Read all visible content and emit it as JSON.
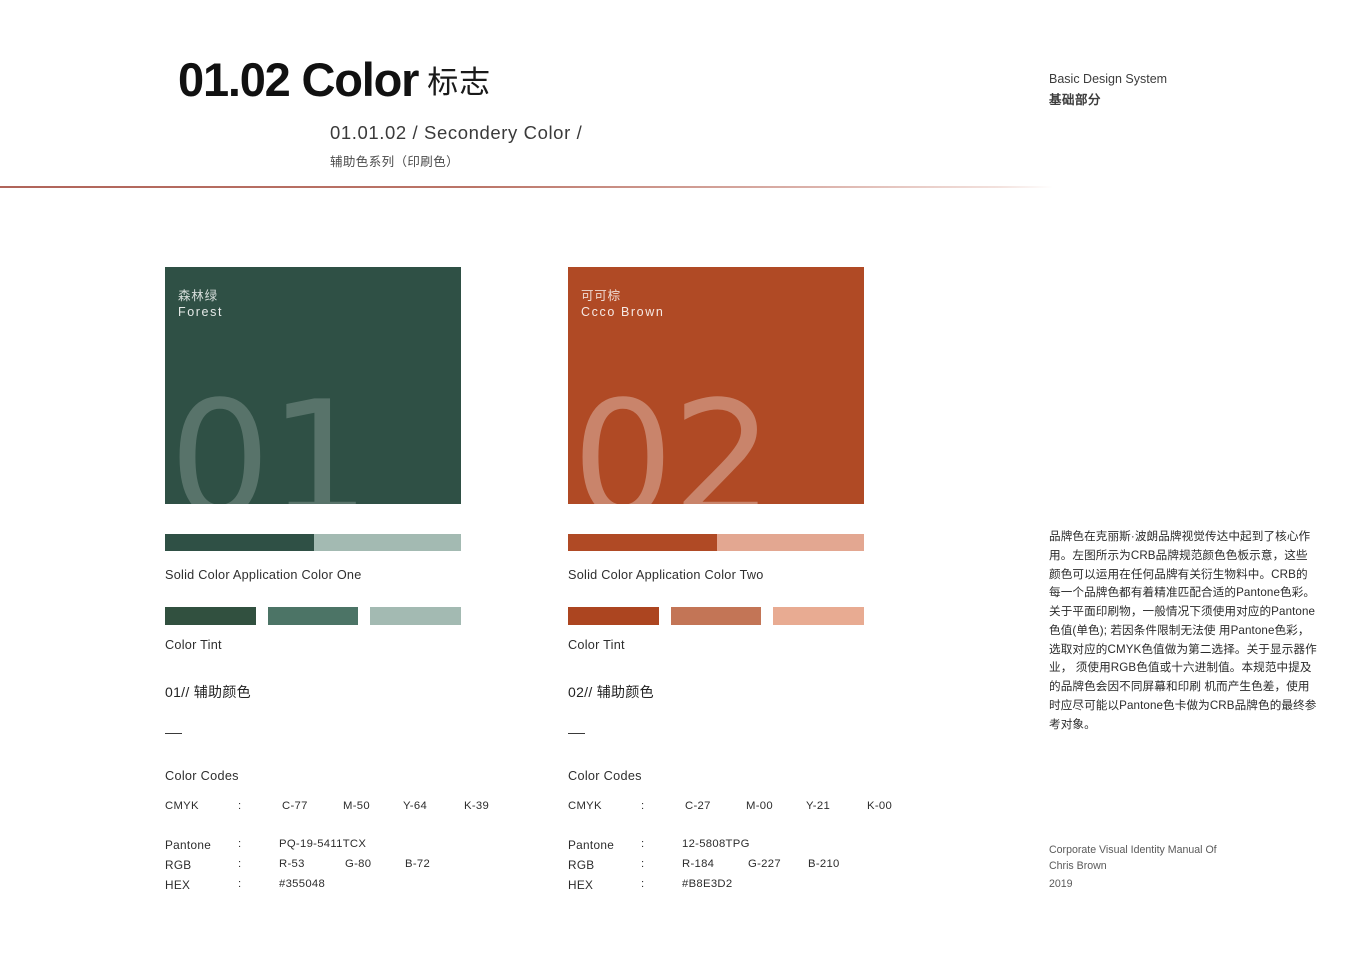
{
  "header": {
    "title_main": "01.02 Color",
    "title_cjk": "标志",
    "subtitle": "01.01.02 /  Secondery Color /",
    "subtitle_cjk": "辅助色系列（印刷色）",
    "right_line1": "Basic Design System",
    "right_line2": "基础部分",
    "rule_color": "#b0645a"
  },
  "columns": [
    {
      "panel": {
        "name_cjk": "森林绿",
        "name_en": "Forest",
        "numeral": "01",
        "bg_color": "#2F5045",
        "numeral_color": "rgba(255,255,255,0.20)"
      },
      "bar": {
        "dark": "#2F5045",
        "light": "#A3BAB2"
      },
      "solid_caption": "Solid Color Application Color One",
      "tints": [
        "#31503F",
        "#4C7466",
        "#A3BAB2"
      ],
      "tint_caption": "Color Tint",
      "codes_title": "01// 辅助颜色",
      "codes_head": "Color Codes",
      "cmyk": {
        "key": "CMYK",
        "colon": ":",
        "c": "C-77",
        "m": "M-50",
        "y": "Y-64",
        "k": "K-39"
      },
      "pantone": {
        "key": "Pantone",
        "colon": ":",
        "value": "PQ-19-5411TCX"
      },
      "rgb": {
        "key": "RGB",
        "colon": ":",
        "r": "R-53",
        "g": "G-80",
        "b": "B-72"
      },
      "hex": {
        "key": "HEX",
        "colon": ":",
        "value": "#355048"
      }
    },
    {
      "panel": {
        "name_cjk": "可可棕",
        "name_en": "Ccco Brown",
        "numeral": "02",
        "bg_color": "#B04A25",
        "numeral_color": "rgba(255,255,255,0.32)"
      },
      "bar": {
        "dark": "#B04A25",
        "light": "#E3A791"
      },
      "solid_caption": "Solid Color Application Color Two",
      "tints": [
        "#AC4520",
        "#C37556",
        "#E8AB92"
      ],
      "tint_caption": "Color Tint",
      "codes_title": "02// 辅助颜色",
      "codes_head": "Color Codes",
      "cmyk": {
        "key": "CMYK",
        "colon": ":",
        "c": "C-27",
        "m": "M-00",
        "y": "Y-21",
        "k": "K-00"
      },
      "pantone": {
        "key": "Pantone",
        "colon": ":",
        "value": "12-5808TPG"
      },
      "rgb": {
        "key": "RGB",
        "colon": ":",
        "r": "R-184",
        "g": "G-227",
        "b": "B-210"
      },
      "hex": {
        "key": "HEX",
        "colon": ":",
        "value": "#B8E3D2"
      }
    }
  ],
  "description": "品牌色在克丽斯·波朗品牌视觉传达中起到了核心作用。左图所示为CRB品牌规范颜色色板示意，这些颜色可以运用在任何品牌有关衍生物料中。CRB的每一个品牌色都有着精准匹配合适的Pantone色彩。关于平面印刷物，一般情况下须使用对应的Pantone色值(单色); 若因条件限制无法使 用Pantone色彩，选取对应的CMYK色值做为第二选择。关于显示器作业， 须使用RGB色值或十六进制值。本规范中提及的品牌色会因不同屏幕和印刷 机而产生色差，使用时应尽可能以Pantone色卡做为CRB品牌色的最终参考对象。",
  "footer": {
    "line1": "Corporate Visual Identity Manual Of",
    "line2": "Chris Brown",
    "year": "2019"
  }
}
